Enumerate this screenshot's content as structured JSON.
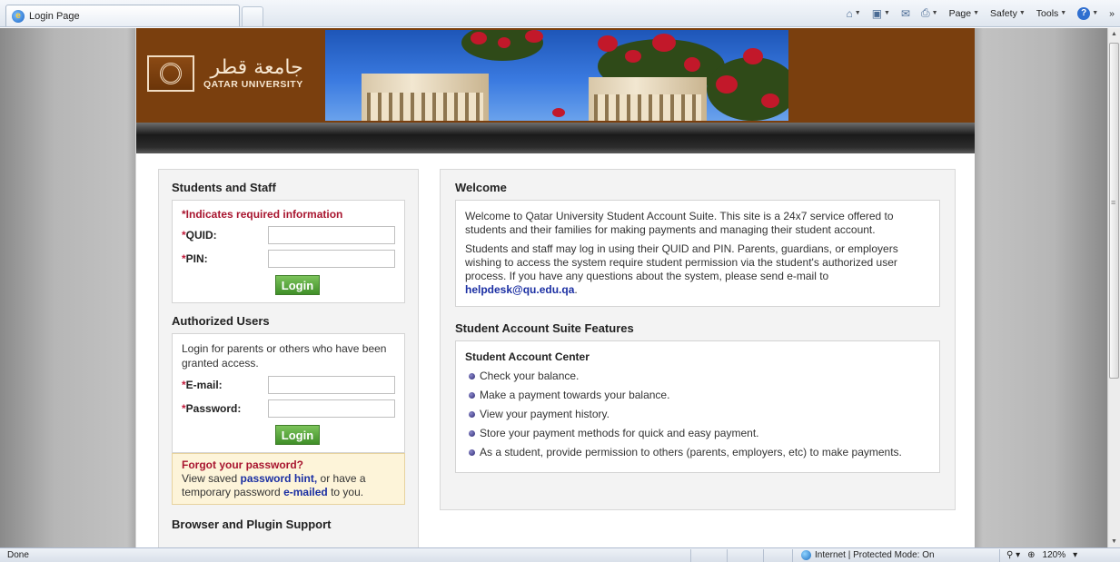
{
  "browser": {
    "tab_title": "Login Page",
    "commands": [
      "Page",
      "Safety",
      "Tools"
    ],
    "more_chevron": "»",
    "status_text": "Done",
    "zone_text": "Internet | Protected Mode: On",
    "zoom_text": "120%"
  },
  "site": {
    "logo_arabic": "جامعة قطر",
    "logo_english": "QATAR UNIVERSITY"
  },
  "login": {
    "students_heading": "Students and Staff",
    "required_note": "*Indicates required information",
    "star": "*",
    "quid_label": "QUID:",
    "pin_label": "PIN:",
    "login_button": "Login"
  },
  "authorized": {
    "heading": "Authorized Users",
    "description": "Login for parents or others who have been granted access.",
    "email_label": "E-mail:",
    "password_label": "Password:",
    "login_button": "Login",
    "forgot_title": "Forgot your password?",
    "forgot_text_1": "View saved",
    "hint_link": "password hint,",
    "forgot_text_2": "or have a temporary password",
    "emailed_link": "e-mailed",
    "forgot_text_3": "to you."
  },
  "browser_support": {
    "heading": "Browser and Plugin Support"
  },
  "welcome": {
    "heading": "Welcome",
    "para1": "Welcome to Qatar University Student Account Suite. This site is a 24x7 service offered to students and their families for making payments and managing their student account.",
    "para2": "Students and staff may log in using their QUID and PIN. Parents, guardians, or employers wishing to access the system require student permission via the student's authorized user process. If you have any questions about the system, please send e-mail to",
    "email_link": "helpdesk@qu.edu.qa",
    "period": "."
  },
  "features": {
    "heading": "Student Account Suite Features",
    "subheading": "Student Account Center",
    "items": [
      "Check your balance.",
      "Make a payment towards your balance.",
      "View your payment history.",
      "Store your payment methods for quick and easy payment.",
      "As a student, provide permission to others (parents, employers, etc) to make payments."
    ]
  }
}
